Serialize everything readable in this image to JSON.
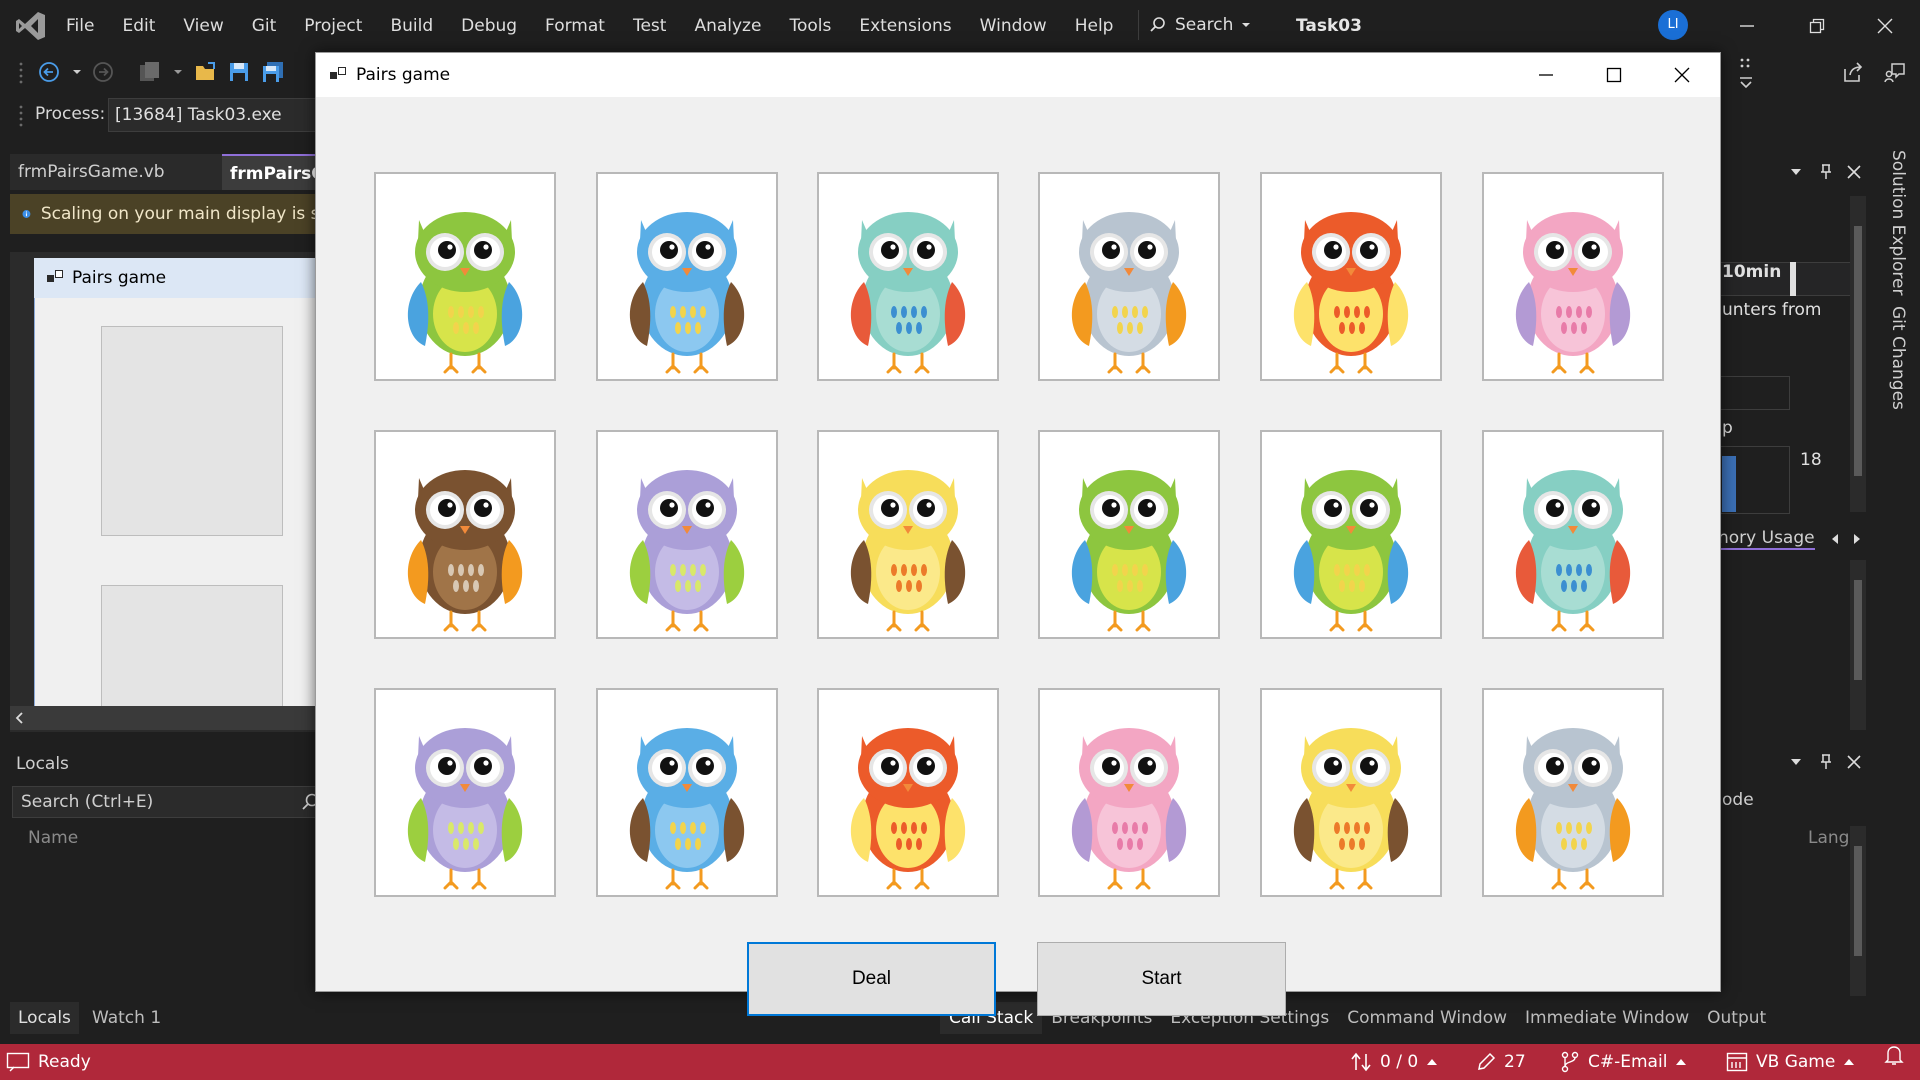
{
  "vs": {
    "menu": [
      "File",
      "Edit",
      "View",
      "Git",
      "Project",
      "Build",
      "Debug",
      "Format",
      "Test",
      "Analyze",
      "Tools",
      "Extensions",
      "Window",
      "Help"
    ],
    "search_label": "Search",
    "solution_name": "Task03",
    "avatar_initials": "LI",
    "process_label": "Process:",
    "process_value": "[13684] Task03.exe",
    "tabs": [
      "frmPairsGame.vb",
      "frmPairsG"
    ],
    "info_text": "Scaling on your main display is se",
    "designer_title": "Pairs game",
    "locals": {
      "title": "Locals",
      "search_placeholder": "Search (Ctrl+E)",
      "column_name": "Name",
      "tabs": [
        "Locals",
        "Watch 1"
      ]
    },
    "bottom_tabs": [
      "Call Stack",
      "Breakpoints",
      "Exception Settings",
      "Command Window",
      "Immediate Window",
      "Output"
    ],
    "right_panel": {
      "timeline_label": "10min",
      "counters_text": "unters from",
      "p_label": "p",
      "value": "18",
      "memory_tab": "nory Usage",
      "code_text": "ode",
      "lang_text": "Lang"
    },
    "vertical_tabs": [
      "Solution Explorer",
      "Git Changes"
    ],
    "status": {
      "ready": "Ready",
      "changes": "0 / 0",
      "edits": "27",
      "repo": "C#-Email",
      "branch": "VB Game"
    },
    "accent": "#b0283a"
  },
  "game": {
    "title": "Pairs game",
    "deal_label": "Deal",
    "start_label": "Start",
    "cards": [
      [
        "green",
        "blue",
        "teal",
        "gray",
        "orange",
        "pink"
      ],
      [
        "brown",
        "purple",
        "yellow",
        "green",
        "green",
        "teal"
      ],
      [
        "purple",
        "blue",
        "orange",
        "pink",
        "yellow",
        "gray"
      ]
    ],
    "owl_colors": {
      "green": {
        "head": "#8dc63f",
        "body": "#8dc63f",
        "belly": "#d7e44a",
        "wing": "#4aa3df",
        "dots": "#f2d44c"
      },
      "blue": {
        "head": "#5aaee6",
        "body": "#5aaee6",
        "belly": "#8cc8f0",
        "wing": "#7a5230",
        "dots": "#f2d44c"
      },
      "teal": {
        "head": "#86cfc3",
        "body": "#86cfc3",
        "belly": "#a8ddd3",
        "wing": "#e85a3a",
        "dots": "#3b8fd1"
      },
      "gray": {
        "head": "#b8c4d0",
        "body": "#b8c4d0",
        "belly": "#d4dce4",
        "wing": "#f39a1f",
        "dots": "#f2d44c"
      },
      "orange": {
        "head": "#ec5b2a",
        "body": "#ec5b2a",
        "belly": "#fde26b",
        "wing": "#fde26b",
        "dots": "#ec5b2a"
      },
      "pink": {
        "head": "#f3a6c3",
        "body": "#f3a6c3",
        "belly": "#f7c4d8",
        "wing": "#b39ad4",
        "dots": "#e87ba8"
      },
      "brown": {
        "head": "#7a5230",
        "body": "#7a5230",
        "belly": "#a07448",
        "wing": "#f39a1f",
        "dots": "#d8c8b4"
      },
      "purple": {
        "head": "#ab9fd8",
        "body": "#ab9fd8",
        "belly": "#c4bbe6",
        "wing": "#9ccf3f",
        "dots": "#d9e86a"
      },
      "yellow": {
        "head": "#f7dd5a",
        "body": "#f7dd5a",
        "belly": "#fbe98a",
        "wing": "#7a5230",
        "dots": "#ec7a2a"
      }
    }
  }
}
